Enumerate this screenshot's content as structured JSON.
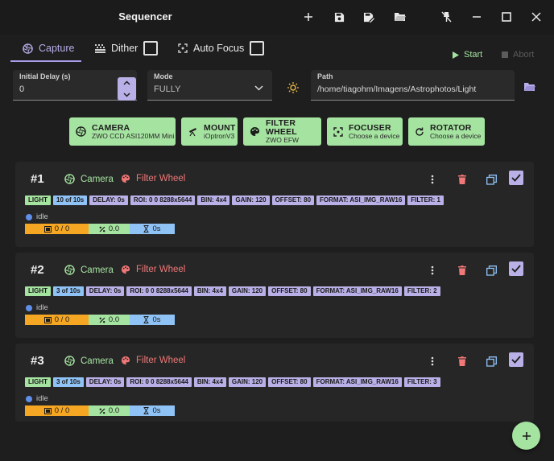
{
  "app": {
    "title": "Sequencer"
  },
  "tabs": [
    {
      "label": "Capture",
      "active": true
    },
    {
      "label": "Dither",
      "checked": false
    },
    {
      "label": "Auto Focus",
      "checked": false
    }
  ],
  "actions": {
    "start": "Start",
    "abort": "Abort"
  },
  "form": {
    "initial_delay": {
      "label": "Initial Delay (s)",
      "value": "0"
    },
    "mode": {
      "label": "Mode",
      "value": "FULLY"
    },
    "path": {
      "label": "Path",
      "value": "/home/tiagohm/Imagens/Astrophotos/Light"
    }
  },
  "devices": [
    {
      "name": "CAMERA",
      "value": "ZWO CCD ASI120MM Mini",
      "icon": "camera-aperture-icon"
    },
    {
      "name": "MOUNT",
      "value": "iOptronV3",
      "icon": "telescope-icon"
    },
    {
      "name": "FILTER WHEEL",
      "value": "ZWO EFW",
      "icon": "palette-icon"
    },
    {
      "name": "FOCUSER",
      "value": "Choose a device",
      "icon": "focus-icon"
    },
    {
      "name": "ROTATOR",
      "value": "Choose a device",
      "icon": "rotate-icon"
    }
  ],
  "sequences": [
    {
      "number": "#1",
      "camera_label": "Camera",
      "filter_label": "Filter Wheel",
      "chips": [
        "LIGHT",
        "10 of 10s",
        "DELAY: 0s",
        "ROI: 0 0 8288x5644",
        "BIN: 4x4",
        "GAIN: 120",
        "OFFSET: 80",
        "FORMAT: ASI_IMG_RAW16",
        "FILTER: 1"
      ],
      "status": "idle",
      "progress": {
        "frames": "0 / 0",
        "percent": "0.0",
        "elapsed": "0s"
      }
    },
    {
      "number": "#2",
      "camera_label": "Camera",
      "filter_label": "Filter Wheel",
      "chips": [
        "LIGHT",
        "3 of 10s",
        "DELAY: 0s",
        "ROI: 0 0 8288x5644",
        "BIN: 4x4",
        "GAIN: 120",
        "OFFSET: 80",
        "FORMAT: ASI_IMG_RAW16",
        "FILTER: 2"
      ],
      "status": "idle",
      "progress": {
        "frames": "0 / 0",
        "percent": "0.0",
        "elapsed": "0s"
      }
    },
    {
      "number": "#3",
      "camera_label": "Camera",
      "filter_label": "Filter Wheel",
      "chips": [
        "LIGHT",
        "3 of 10s",
        "DELAY: 0s",
        "ROI: 0 0 8288x5644",
        "BIN: 4x4",
        "GAIN: 120",
        "OFFSET: 80",
        "FORMAT: ASI_IMG_RAW16",
        "FILTER: 3"
      ],
      "status": "idle",
      "progress": {
        "frames": "0 / 0",
        "percent": "0.0",
        "elapsed": "0s"
      }
    }
  ],
  "colors": {
    "accent": "#b8b0e6",
    "success": "#a5e3a0",
    "danger": "#f07878",
    "info": "#90c3f5",
    "warning": "#f5a623",
    "background": "#1e1e1e",
    "card": "#262626"
  }
}
